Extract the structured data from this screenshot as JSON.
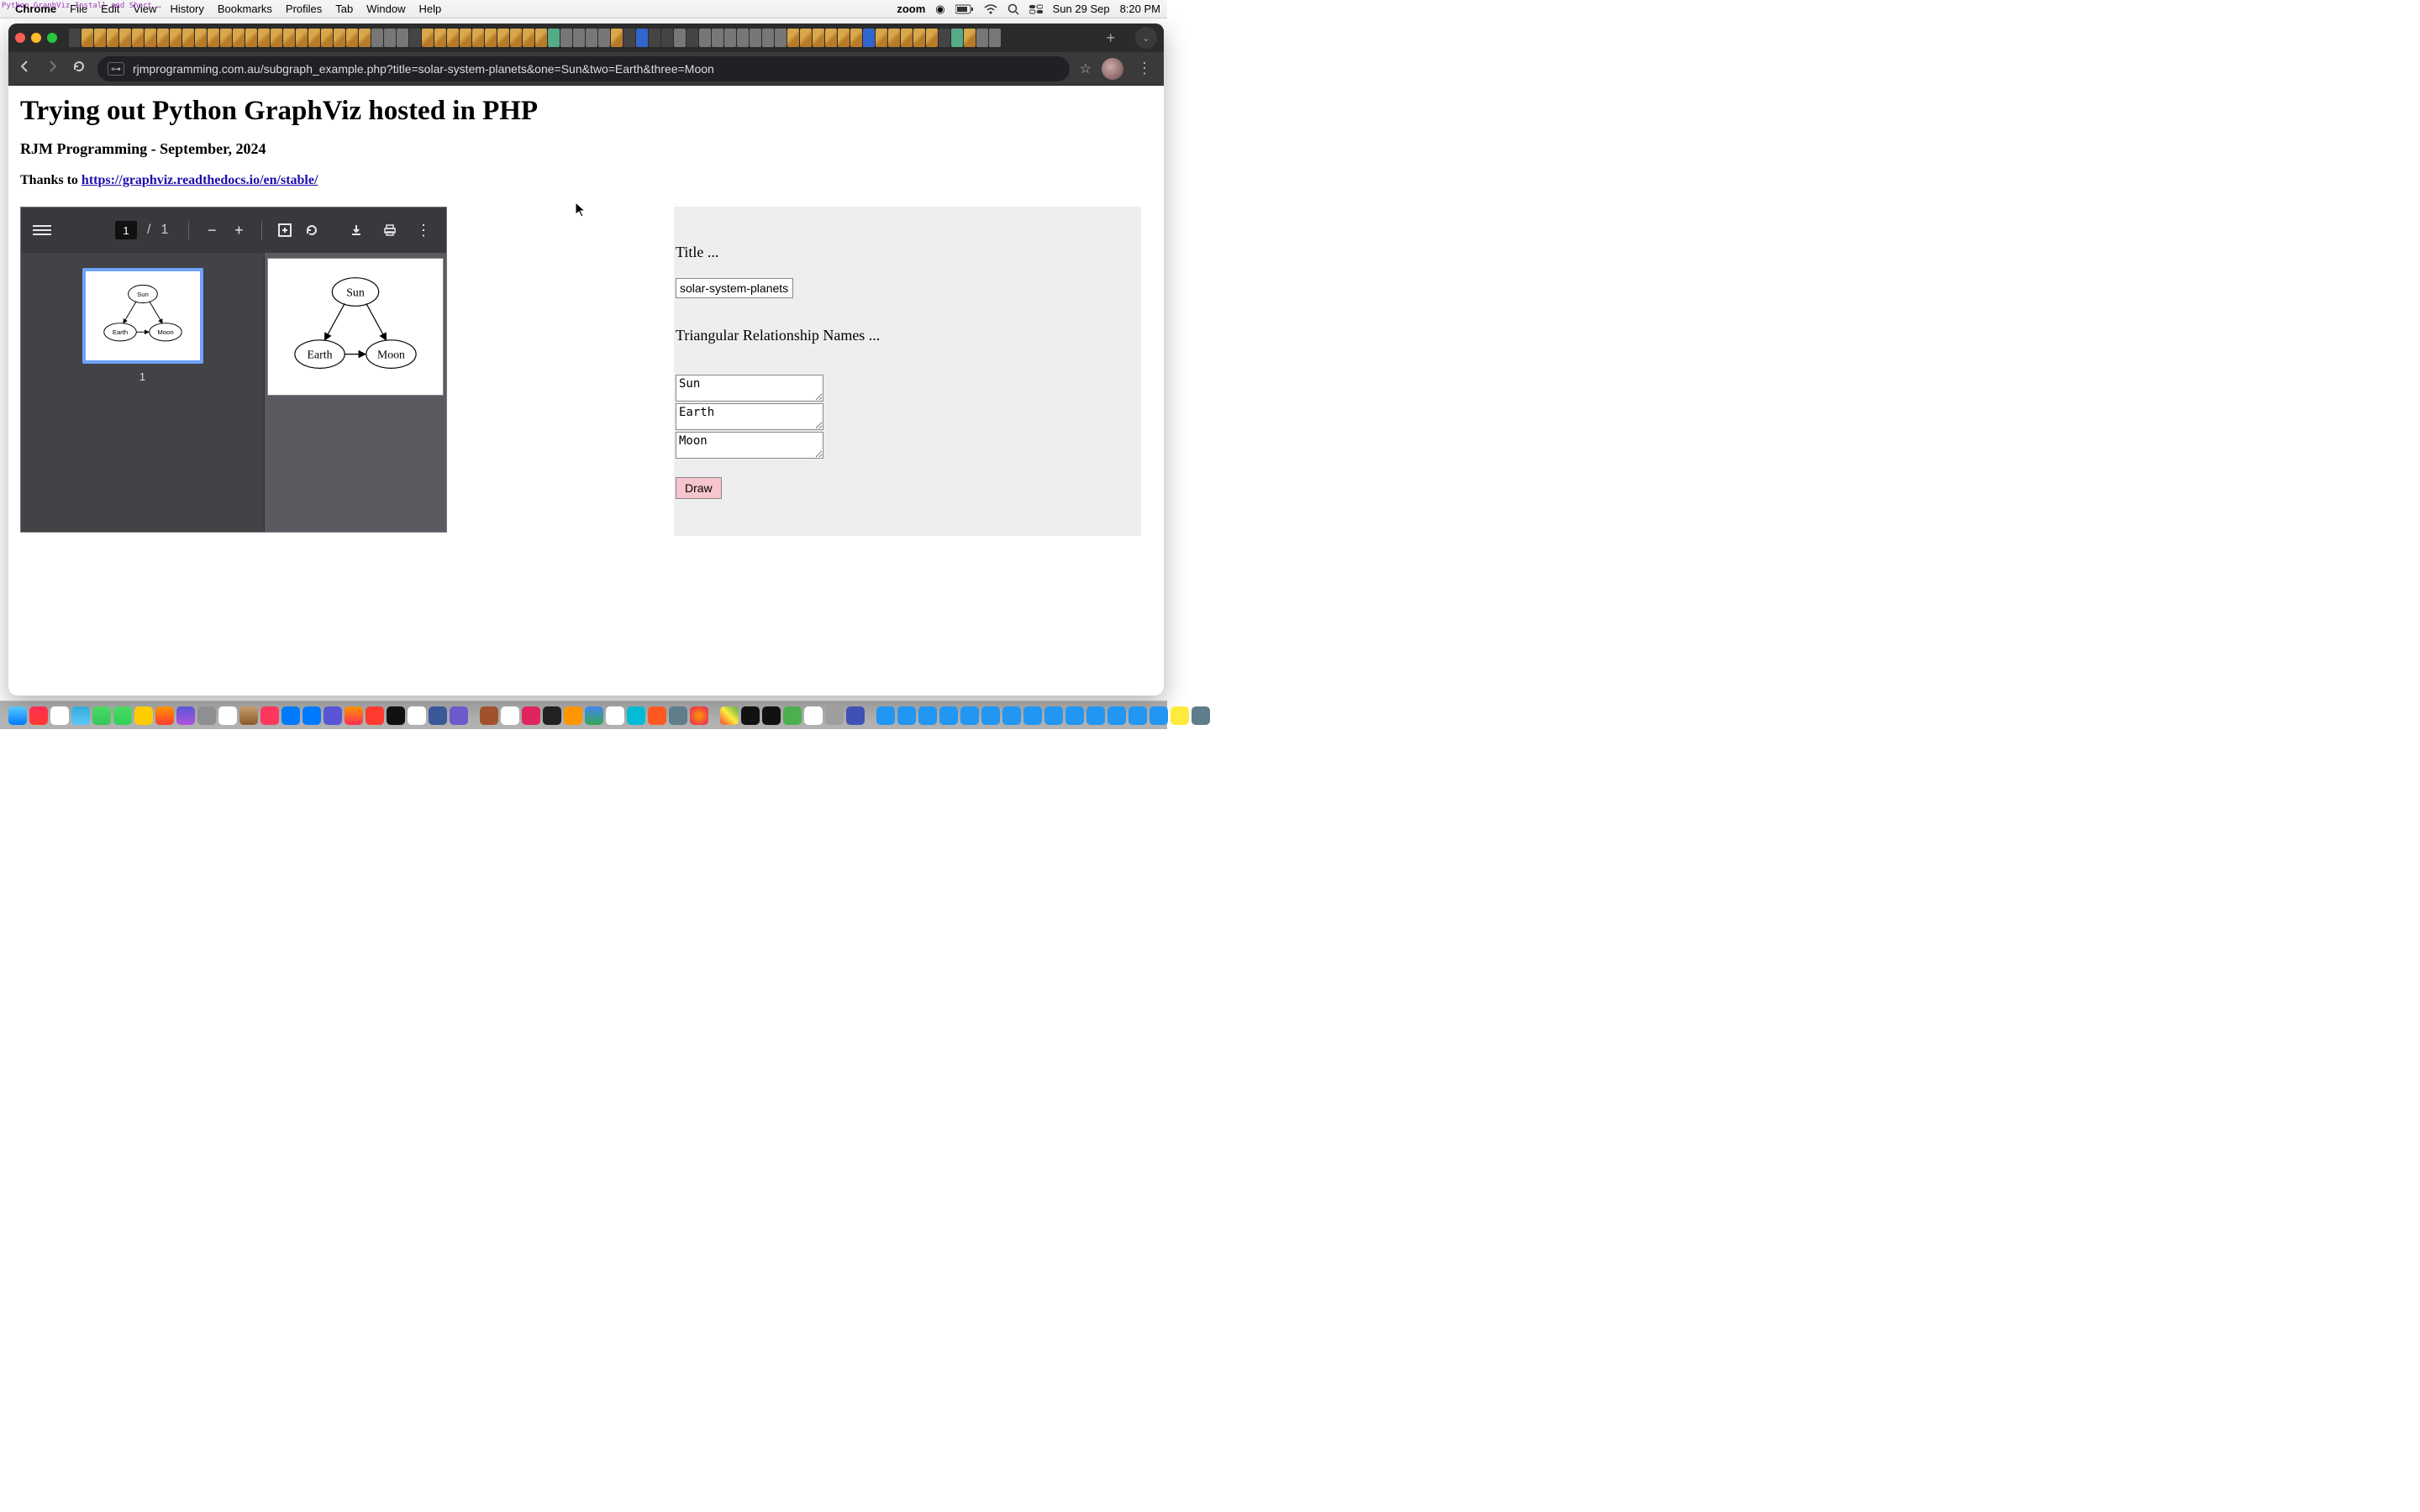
{
  "menubar": {
    "app": "Chrome",
    "items": [
      "File",
      "Edit",
      "View",
      "History",
      "Bookmarks",
      "Profiles",
      "Tab",
      "Window",
      "Help"
    ],
    "zoom": "zoom",
    "date": "Sun 29 Sep",
    "time": "8:20 PM",
    "floating_note": "Python GraphViz Install and Short …"
  },
  "browser": {
    "url": "rjmprogramming.com.au/subgraph_example.php?title=solar-system-planets&one=Sun&two=Earth&three=Moon",
    "new_tab_label": "+",
    "tabs_chevron": "⌄"
  },
  "page": {
    "title": "Trying out Python GraphViz hosted in PHP",
    "subtitle": "RJM Programming - September, 2024",
    "thanks_prefix": "Thanks to ",
    "thanks_link_text": "https://graphviz.readthedocs.io/en/stable/"
  },
  "pdf": {
    "current_page": "1",
    "page_sep": "/",
    "total_pages": "1",
    "thumb_label": "1",
    "graph": {
      "top": "Sun",
      "left": "Earth",
      "right": "Moon"
    }
  },
  "form": {
    "title_label": "Title ...",
    "title_value": "solar-system-planets",
    "rel_label": "Triangular Relationship Names ...",
    "one": "Sun",
    "two": "Earth",
    "three": "Moon",
    "submit": "Draw"
  }
}
